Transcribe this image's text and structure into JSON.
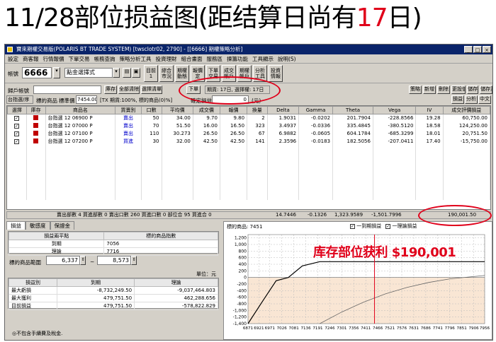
{
  "title": {
    "prefix": "11/28部位损益图(距结算日尚有",
    "days": "17",
    "suffix": "日)"
  },
  "window": {
    "title": "寶來期權交易版(POLARIS BT TRADE SYSTEM)  [twsclotr02, 2790]  - [[6666] 期權策略分析]"
  },
  "menu": [
    "設定",
    "商客報",
    "行情報價",
    "下單交易",
    "帳務查詢",
    "策略分析工具",
    "投資理財",
    "組合畫面",
    "服務區",
    "揀籌功能",
    "工具顯示",
    "說明(S)"
  ],
  "toolbar": {
    "account_label": "帳號",
    "account_value": "6666",
    "strategy_select": "點金選擇式",
    "buttons": [
      "目前\n1",
      "綜合\n市況",
      "期權\n動態",
      "報價\n定",
      "下單\n交易",
      "成交\n帳戶",
      "期權\n帳戶",
      "分析\n工具",
      "投資\n情報"
    ]
  },
  "row2": {
    "label": "歸戶帳號",
    "buttons": [
      "庫存",
      "全部清除",
      "選擇清單",
      "下單"
    ],
    "period": "期貨: 17日, 選擇權: 17日",
    "right_buttons": [
      "策略",
      "新增",
      "刪除",
      "更設值",
      "儲存",
      "儲存清單"
    ]
  },
  "row3": {
    "product": "台指選/序",
    "underlying_label": "標的商品",
    "std_label": "標準價",
    "std_value": "7454.00",
    "tx_text": "[TX 期貨:100%, 標的商品(0)%]",
    "confirm_label": "確定損益",
    "confirm_value": "0",
    "unit": "(元)",
    "right_buttons": [
      "損益",
      "分析",
      "中文"
    ]
  },
  "grid": {
    "headers": [
      "選擇",
      "庫存",
      "商品名",
      "買賣別",
      "口數",
      "平均價",
      "成交價",
      "報價",
      "換量",
      "Delta",
      "Gamma",
      "Theta",
      "Vega",
      "IV",
      "成交評價損益"
    ],
    "rows": [
      {
        "check": "✓",
        "name": "台指選 12 06900 P",
        "side": "賣出",
        "qty": "50",
        "avg": "34.00",
        "trade": "9.70",
        "quote": "9.80",
        "vol": "2",
        "delta": "1.9031",
        "gamma": "-0.0202",
        "theta": "201.7904",
        "vega": "-228.8566",
        "iv": "19.28",
        "pnl": "60,750.00"
      },
      {
        "check": "✓",
        "name": "台指選 12 07000 P",
        "side": "賣出",
        "qty": "70",
        "avg": "51.50",
        "trade": "16.00",
        "quote": "16.50",
        "vol": "323",
        "delta": "3.4937",
        "gamma": "-0.0336",
        "theta": "335.4845",
        "vega": "-380.5120",
        "iv": "18.58",
        "pnl": "124,250.00"
      },
      {
        "check": "✓",
        "name": "台指選 12 07100 P",
        "side": "賣出",
        "qty": "110",
        "avg": "30.273",
        "trade": "26.50",
        "quote": "26.50",
        "vol": "67",
        "delta": "6.9882",
        "gamma": "-0.0605",
        "theta": "604.1784",
        "vega": "-685.3299",
        "iv": "18.01",
        "pnl": "20,751.50"
      },
      {
        "check": "✓",
        "name": "台指選 12 07200 P",
        "side": "買進",
        "qty": "30",
        "avg": "32.00",
        "trade": "42.50",
        "quote": "42.50",
        "vol": "141",
        "delta": "2.3596",
        "gamma": "-0.0183",
        "theta": "182.5056",
        "vega": "-207.0411",
        "iv": "17.40",
        "pnl": "-15,750.00"
      }
    ]
  },
  "summary": {
    "text": "賣出部數 4  買進部數 0  賣出口數 260  買進口數 0  部位合 95  買進合 0",
    "delta": "14.7446",
    "gamma": "-0.1326",
    "theta": "1,323.9589",
    "vega": "-1,501.7996",
    "total": "190,001.50"
  },
  "left_panel": {
    "tabs": [
      "損益",
      "敏感度",
      "保證金"
    ],
    "section_header": [
      "損益兩平點",
      "標的商品指數"
    ],
    "rows": [
      [
        "到期",
        "7056"
      ],
      [
        "理論",
        "7716"
      ]
    ],
    "range_label": "標的商品範圍",
    "range_from": "6,337",
    "range_to": "8,573",
    "unit_label": "單位：元",
    "pl_headers": [
      "損益別",
      "到期",
      "理論"
    ],
    "pl_rows": [
      [
        "最大虧損",
        "-8,732,249.50",
        "-9,037,464.803"
      ],
      [
        "最大獲利",
        "479,751.50",
        "462,288.656"
      ],
      [
        "目前損益",
        "479,751.50",
        "-578,822.829"
      ]
    ],
    "note": "◎不包含手續費及稅金."
  },
  "chart_panel": {
    "underlying_label": "標的商品: 7451",
    "legend": [
      "一到期損益",
      "一理論損益"
    ],
    "annotation": "库存部位获利 $190,001"
  },
  "chart_data": {
    "type": "line",
    "x": [
      6871,
      6921,
      6971,
      7026,
      7081,
      7136,
      7191,
      7246,
      7301,
      7356,
      7411,
      7466,
      7521,
      7576,
      7631,
      7686,
      7741,
      7796,
      7851,
      7906,
      7956
    ],
    "xlabels": [
      "6871",
      "6921",
      "6971",
      "7026",
      "7081",
      "7136",
      "7191",
      "7246",
      "7301",
      "7356",
      "7411",
      "7466",
      "7521",
      "7576",
      "7631",
      "7686",
      "7741",
      "7796",
      "7851",
      "7906",
      "7956"
    ],
    "yticks": [
      "1,200",
      "1,000",
      "800",
      "600",
      "400",
      "200",
      "0",
      "-200",
      "-400",
      "-600",
      "-800",
      "-1,000",
      "-1,200",
      "-1,400"
    ],
    "ylim": [
      -1400,
      1300
    ],
    "current_x": 7451,
    "series": [
      {
        "name": "一到期損益",
        "color": "#000000",
        "points": [
          [
            6871,
            -1400
          ],
          [
            6940,
            -700
          ],
          [
            7000,
            -100
          ],
          [
            7056,
            0
          ],
          [
            7120,
            350
          ],
          [
            7200,
            479
          ],
          [
            7956,
            479
          ]
        ]
      },
      {
        "name": "一理論損益",
        "color": "#666666",
        "points": [
          [
            7200,
            -1400
          ],
          [
            7300,
            -1050
          ],
          [
            7400,
            -750
          ],
          [
            7500,
            -500
          ],
          [
            7600,
            -300
          ],
          [
            7700,
            -150
          ],
          [
            7800,
            -40
          ],
          [
            7956,
            60
          ]
        ]
      }
    ]
  }
}
